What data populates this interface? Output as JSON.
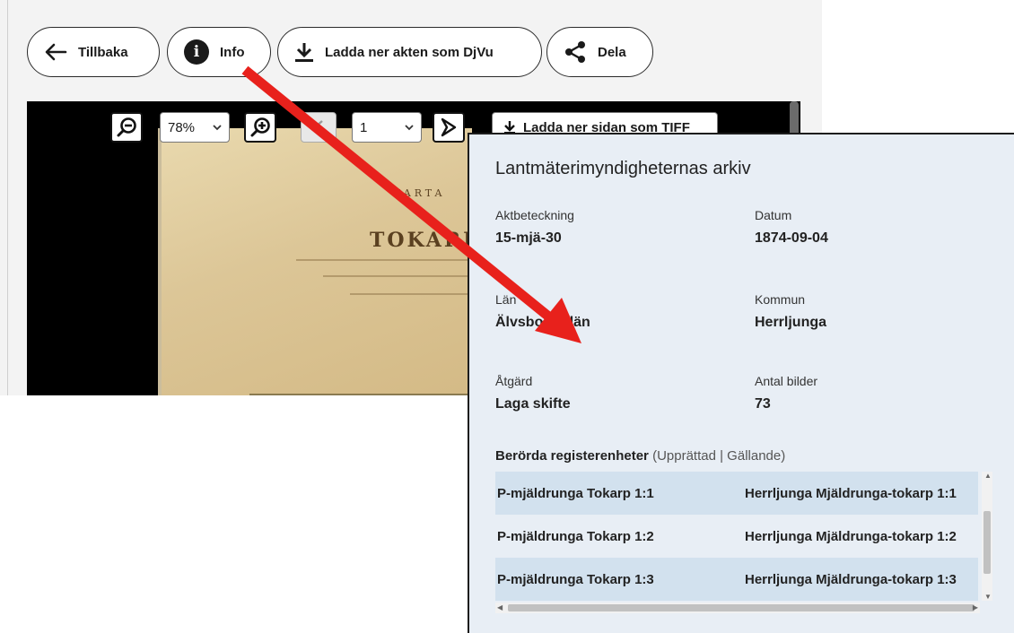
{
  "toolbar": {
    "back_label": "Tillbaka",
    "info_label": "Info",
    "download_label": "Ladda ner akten som DjVu",
    "share_label": "Dela"
  },
  "viewer": {
    "zoom_value": "78%",
    "page_value": "1",
    "download_page_label": "Ladda ner sidan som TIFF"
  },
  "map": {
    "line1": "KARTA",
    "line2": "TOKARP"
  },
  "panel": {
    "title": "Lantmäterimyndigheternas arkiv",
    "fields": {
      "aktbeteckning_label": "Aktbeteckning",
      "aktbeteckning_value": "15-mjä-30",
      "datum_label": "Datum",
      "datum_value": "1874-09-04",
      "lan_label": "Län",
      "lan_value": "Älvsborgs län",
      "kommun_label": "Kommun",
      "kommun_value": "Herrljunga",
      "atgard_label": "Åtgärd",
      "atgard_value": "Laga skifte",
      "antal_label": "Antal bilder",
      "antal_value": "73"
    },
    "section_title": "Berörda registerenheter",
    "section_sub": "(Upprättad | Gällande)",
    "rows": [
      {
        "upprattad": "P-mjäldrunga Tokarp 1:1",
        "gallande": "Herrljunga Mjäldrunga-tokarp 1:1"
      },
      {
        "upprattad": "P-mjäldrunga Tokarp 1:2",
        "gallande": "Herrljunga Mjäldrunga-tokarp 1:2"
      },
      {
        "upprattad": "P-mjäldrunga Tokarp 1:3",
        "gallande": "Herrljunga Mjäldrunga-tokarp 1:3"
      }
    ]
  },
  "colors": {
    "arrow": "#e8211c",
    "panel_bg": "#e8eef5",
    "row_shade": "#d2e1ee"
  }
}
